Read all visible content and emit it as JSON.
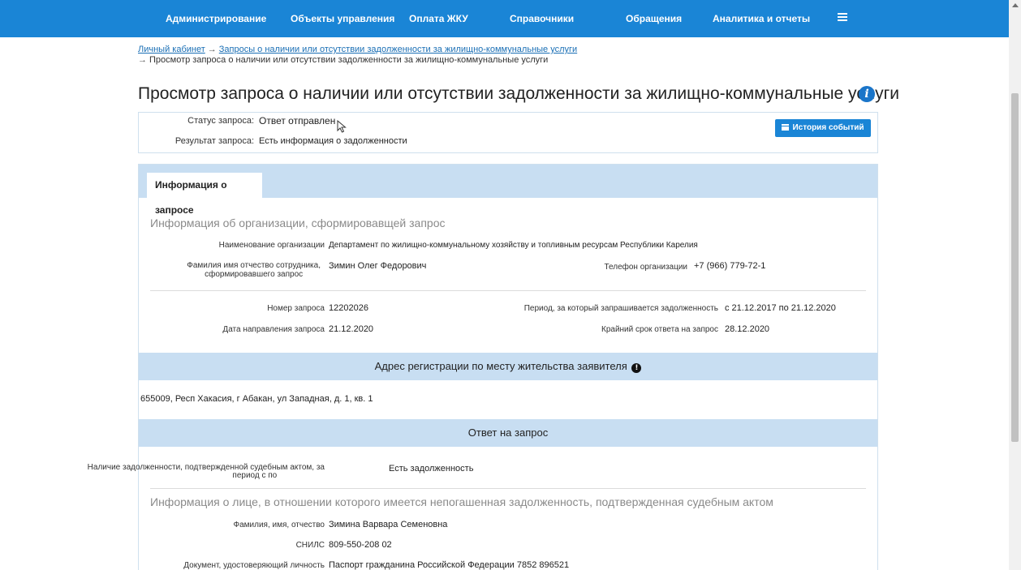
{
  "nav": {
    "items": [
      "Администрирование",
      "Объекты управления",
      "Оплата ЖКУ",
      "Справочники",
      "Обращения",
      "Аналитика и отчеты"
    ],
    "menu_icon": "hamburger-icon"
  },
  "breadcrumb": {
    "link1": "Личный кабинет",
    "link2": "Запросы о наличии или отсутствии задолженности за жилищно-коммунальные услуги",
    "current": "Просмотр запроса о наличии или отсутствии задолженности за жилищно-коммунальные услуги",
    "arrow": "→"
  },
  "page": {
    "title": "Просмотр запроса о наличии или отсутствии задолженности за жилищно-коммунальные услуги",
    "info_icon": "i"
  },
  "status": {
    "status_label": "Статус запроса:",
    "status_value": "Ответ отправлен",
    "result_label": "Результат запроса:",
    "result_value": "Есть информация о задолженности",
    "history_button": "История событий"
  },
  "tabs": [
    "Информация о запросе"
  ],
  "org_section": {
    "title": "Информация об организации, сформировавщей запрос",
    "name_label": "Наименование организации",
    "name_value": "Департамент по жилищно-коммунальному хозяйству и топливным ресурсам Республики Карелия",
    "employee_label_1": "Фамилия имя отчество сотрудника,",
    "employee_label_2": "сформировавшего запрос",
    "employee_value": "Зимин Олег Федорович",
    "phone_label": "Телефон организации",
    "phone_value": "+7 (966) 779-72-1"
  },
  "request": {
    "number_label": "Номер запроса",
    "number_value": "12202026",
    "date_label": "Дата направления запроса",
    "date_value": "21.12.2020",
    "period_label": "Период, за который запрашивается задолженность",
    "period_value": "с 21.12.2017 по 21.12.2020",
    "deadline_label": "Крайний срок ответа на запрос",
    "deadline_value": "28.12.2020"
  },
  "address": {
    "title": "Адрес регистрации по месту жительства заявителя",
    "value": "655009, Респ Хакасия, г Абакан, ул Западная, д. 1, кв. 1"
  },
  "answer": {
    "title": "Ответ на запрос",
    "debt_label_1": "Наличие задолженности, подтвержденной судебным актом, за",
    "debt_label_2": "период с по",
    "debt_value": "Есть задолженность",
    "person_title": "Информация о лице, в отношении которого имеется непогашенная задолженность, подтвержденная судебным актом",
    "fio_label": "Фамилия, имя, отчество",
    "fio_value": "Зимина Варвара Семеновна",
    "snils_label": "СНИЛС",
    "snils_value": "809-550-208 02",
    "doc_label": "Документ, удостоверяющий личность",
    "doc_value": "Паспорт гражданина Российской Федерации 7852 896521"
  }
}
